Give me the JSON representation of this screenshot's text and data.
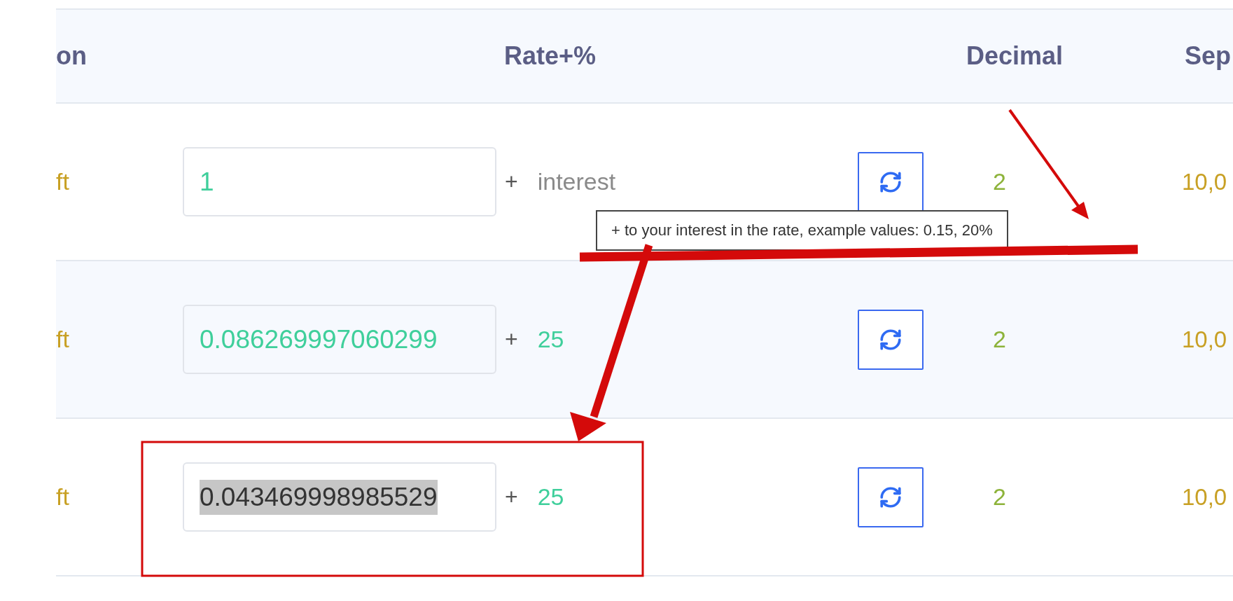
{
  "table": {
    "columns": [
      "on",
      "Rate+%",
      "Decimal",
      "Sep"
    ],
    "rows": [
      {
        "column_1": "ft",
        "rate": "1",
        "rate_selected": false,
        "plus": "+",
        "addend": {
          "text": "interest",
          "kind": "hint"
        },
        "decimal": "2",
        "separator": "10,0"
      },
      {
        "column_1": "ft",
        "rate": "0.086269997060299",
        "rate_selected": false,
        "plus": "+",
        "addend": {
          "text": "25",
          "kind": "value"
        },
        "decimal": "2",
        "separator": "10,0"
      },
      {
        "column_1": "ft",
        "rate": "0.043469998985529",
        "rate_selected": true,
        "plus": "+",
        "addend": {
          "text": "25",
          "kind": "value"
        },
        "decimal": "2",
        "separator": "10,0"
      }
    ]
  },
  "tooltip": {
    "text": "+ to your interest in the rate, example values: 0.15, 20%"
  }
}
